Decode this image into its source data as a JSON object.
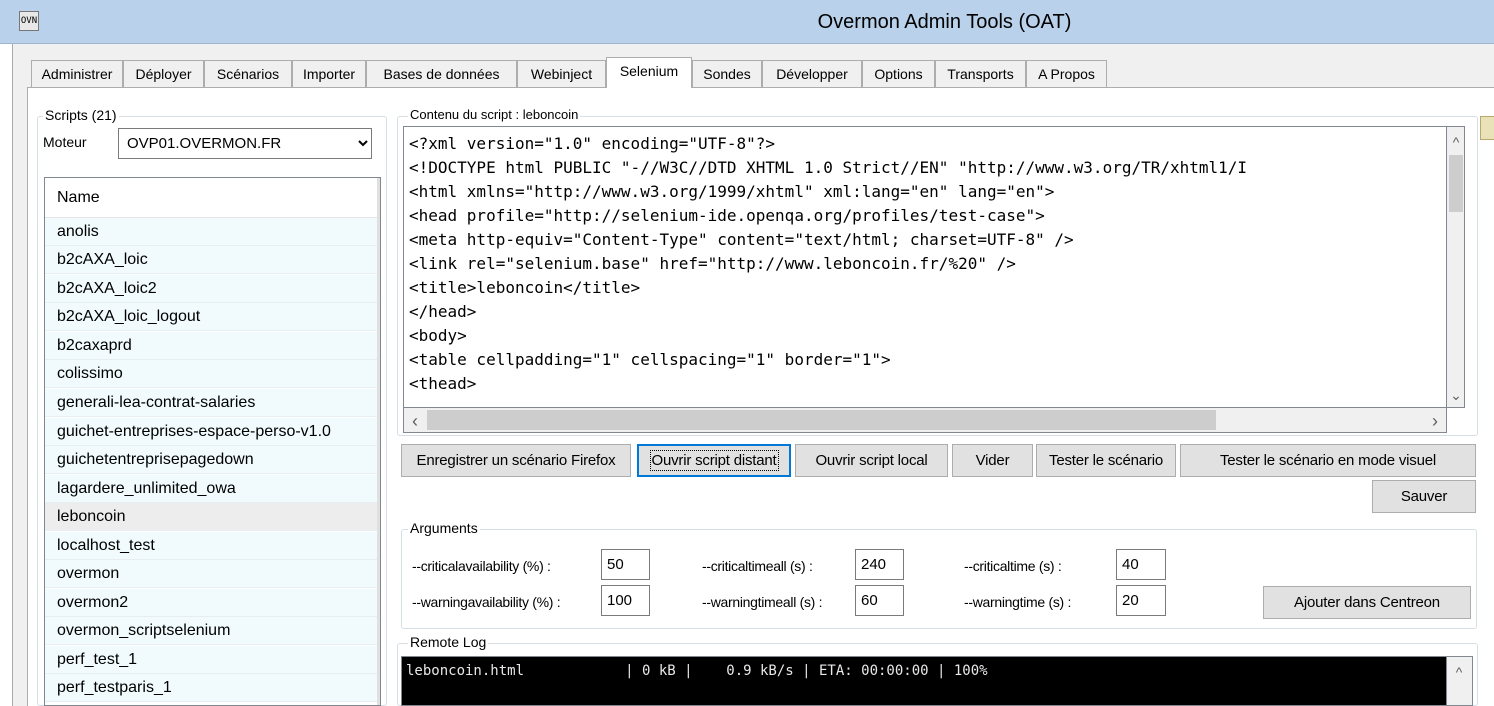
{
  "window": {
    "title": "Overmon Admin Tools (OAT)",
    "icon": "app-logo-icon",
    "icon_text": "OVN"
  },
  "tabs": [
    {
      "label": "Administrer"
    },
    {
      "label": "Déployer"
    },
    {
      "label": "Scénarios"
    },
    {
      "label": "Importer"
    },
    {
      "label": "Bases de données"
    },
    {
      "label": "Webinject"
    },
    {
      "label": "Selenium"
    },
    {
      "label": "Sondes"
    },
    {
      "label": "Développer"
    },
    {
      "label": "Options"
    },
    {
      "label": "Transports"
    },
    {
      "label": "A Propos"
    }
  ],
  "active_tab": "Selenium",
  "scripts": {
    "group_label": "Scripts (21)",
    "engine_label": "Moteur",
    "engine_value": "OVP01.OVERMON.FR",
    "column_header": "Name",
    "items": [
      "anolis",
      "b2cAXA_loic",
      "b2cAXA_loic2",
      "b2cAXA_loic_logout",
      "b2caxaprd",
      "colissimo",
      "generali-lea-contrat-salaries",
      "guichet-entreprises-espace-perso-v1.0",
      "guichetentreprisepagedown",
      "lagardere_unlimited_owa",
      "leboncoin",
      "localhost_test",
      "overmon",
      "overmon2",
      "overmon_scriptselenium",
      "perf_test_1",
      "perf_testparis_1"
    ],
    "selected": "leboncoin"
  },
  "script_content": {
    "group_label": "Contenu du script : leboncoin",
    "lines": [
      "<?xml version=\"1.0\" encoding=\"UTF-8\"?>",
      "<!DOCTYPE html PUBLIC \"-//W3C//DTD XHTML 1.0 Strict//EN\" \"http://www.w3.org/TR/xhtml1/I",
      "<html xmlns=\"http://www.w3.org/1999/xhtml\" xml:lang=\"en\" lang=\"en\">",
      "<head profile=\"http://selenium-ide.openqa.org/profiles/test-case\">",
      "<meta http-equiv=\"Content-Type\" content=\"text/html; charset=UTF-8\" />",
      "<link rel=\"selenium.base\" href=\"http://www.leboncoin.fr/%20\" />",
      "<title>leboncoin</title>",
      "</head>",
      "<body>",
      "<table cellpadding=\"1\" cellspacing=\"1\" border=\"1\">",
      "<thead>"
    ]
  },
  "buttons": {
    "record_firefox": "Enregistrer un scénario Firefox",
    "open_remote": "Ouvrir script distant",
    "open_local": "Ouvrir script local",
    "clear": "Vider",
    "test_scenario": "Tester le scénario",
    "test_visual": "Tester le scénario en mode visuel",
    "save": "Sauver",
    "add_centreon": "Ajouter dans Centreon"
  },
  "arguments": {
    "group_label": "Arguments",
    "fields": [
      {
        "label": "--criticalavailability (%) :",
        "value": "50"
      },
      {
        "label": "--criticaltimeall (s) :",
        "value": "240"
      },
      {
        "label": "--criticaltime (s) :",
        "value": "40"
      },
      {
        "label": "--warningavailability (%) :",
        "value": "100"
      },
      {
        "label": "--warningtimeall (s) :",
        "value": "60"
      },
      {
        "label": "--warningtime (s) :",
        "value": "20"
      }
    ]
  },
  "remote_log": {
    "group_label": "Remote Log",
    "text": "leboncoin.html            | 0 kB |    0.9 kB/s | ETA: 00:00:00 | 100%"
  },
  "colors": {
    "titlebar": "#b9d1ea",
    "list_row": "#f1fbfe",
    "log_bg": "#000000"
  }
}
